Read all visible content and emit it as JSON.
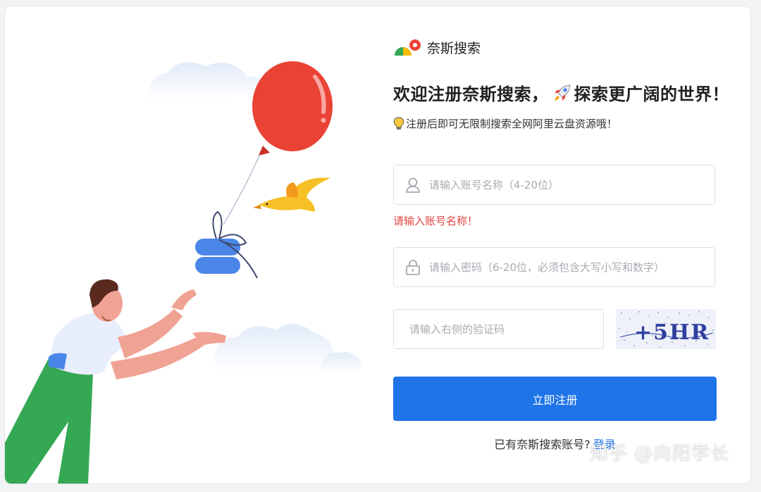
{
  "brand": {
    "name": "奈斯搜索",
    "logo_icon": "nice-search-logo-icon"
  },
  "headline": {
    "part1": "欢迎注册奈斯搜索，",
    "rocket_icon": "rocket-icon",
    "part2": "探索更广阔的世界！"
  },
  "tip": {
    "bulb_icon": "lightbulb-icon",
    "text": "注册后即可无限制搜索全网阿里云盘资源哦！"
  },
  "form": {
    "username": {
      "placeholder": "请输入账号名称（4-20位）",
      "value": "",
      "icon": "user-icon"
    },
    "username_error": "请输入账号名称！",
    "password": {
      "placeholder": "请输入密码（6-20位，必须包含大写小写和数字）",
      "value": "",
      "icon": "lock-icon"
    },
    "captcha": {
      "placeholder": "请输入右侧的验证码",
      "value": "",
      "image_text": "+5HR"
    },
    "submit_label": "立即注册",
    "login_prompt": "已有奈斯搜索账号?",
    "login_link": "登录"
  },
  "watermark": "知乎 @向阳学长",
  "colors": {
    "primary": "#1f74e8",
    "error": "#e0443f",
    "balloon": "#ea4335",
    "gift": "#4a86e8",
    "bird": "#f6c026",
    "pants": "#34a853"
  }
}
